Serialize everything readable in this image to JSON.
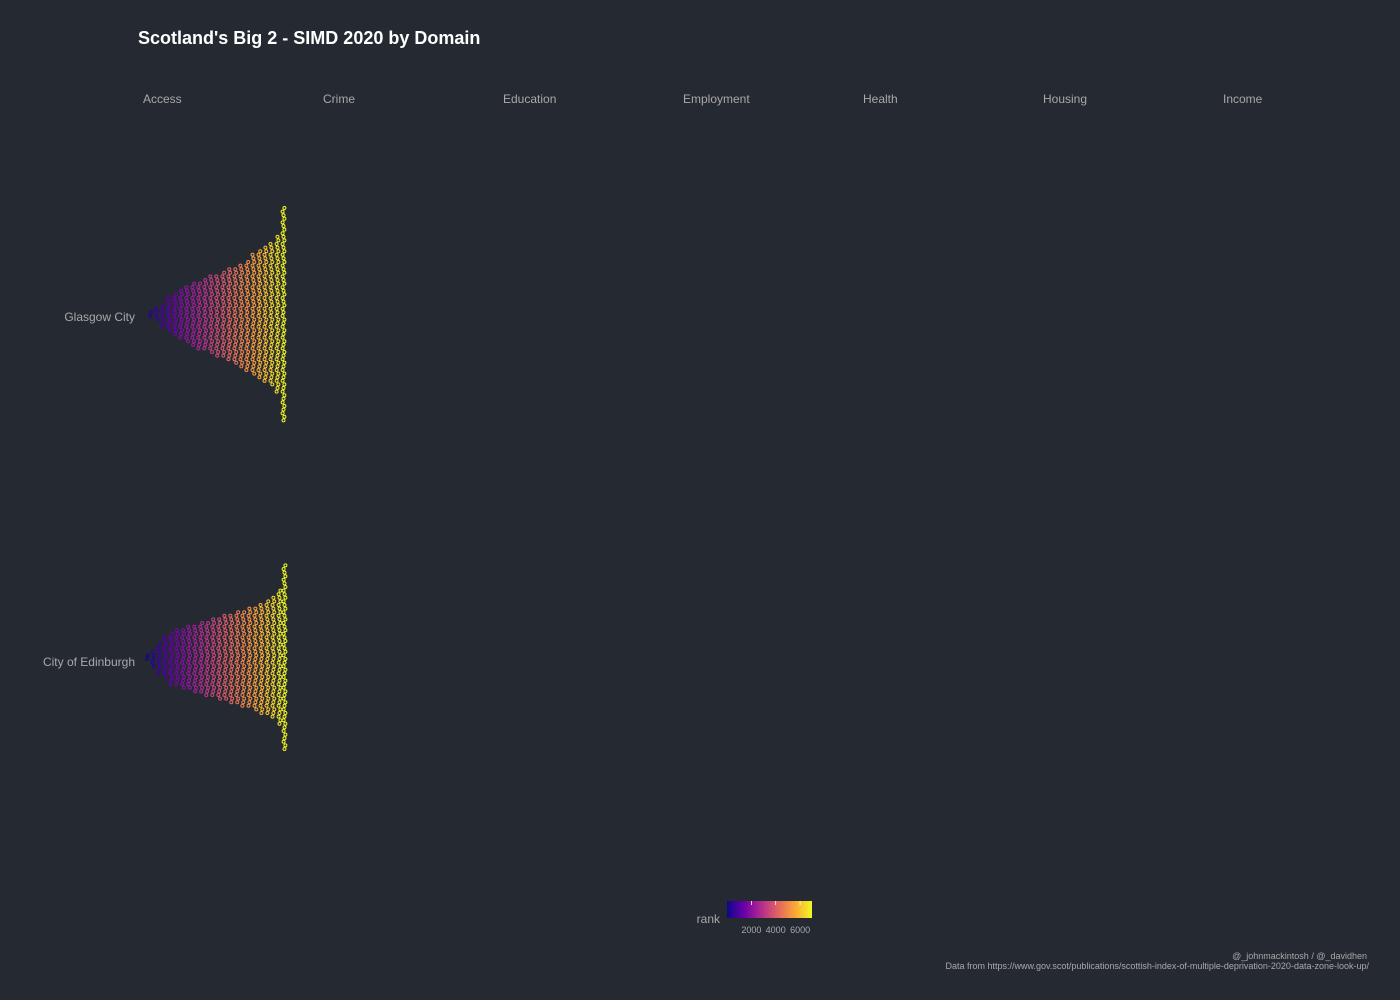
{
  "chart_data": {
    "type": "scatter",
    "title": "Scotland's Big 2 - SIMD 2020 by Domain",
    "facets": [
      "Access",
      "Crime",
      "Education",
      "Employment",
      "Health",
      "Housing",
      "Income"
    ],
    "rows": [
      "Glasgow City",
      "City of Edinburgh"
    ],
    "color_variable": "rank",
    "color_scale": {
      "name": "plasma",
      "colors": [
        "#0d0887",
        "#6a00a8",
        "#b12a90",
        "#e16462",
        "#fca636",
        "#f0f921"
      ],
      "domain": [
        1,
        6976
      ],
      "legend_ticks": [
        "2000",
        "4000",
        "6000"
      ]
    },
    "series": [
      {
        "row": "Glasgow City",
        "facet": "Access",
        "rank_bins": [
          {
            "rank": 300,
            "count": 2
          },
          {
            "rank": 600,
            "count": 4
          },
          {
            "rank": 900,
            "count": 7
          },
          {
            "rank": 1200,
            "count": 10
          },
          {
            "rank": 1500,
            "count": 12
          },
          {
            "rank": 1800,
            "count": 14
          },
          {
            "rank": 2100,
            "count": 16
          },
          {
            "rank": 2400,
            "count": 18
          },
          {
            "rank": 2700,
            "count": 19
          },
          {
            "rank": 3000,
            "count": 20
          },
          {
            "rank": 3300,
            "count": 22
          },
          {
            "rank": 3600,
            "count": 23
          },
          {
            "rank": 3900,
            "count": 24
          },
          {
            "rank": 4200,
            "count": 26
          },
          {
            "rank": 4500,
            "count": 27
          },
          {
            "rank": 4800,
            "count": 29
          },
          {
            "rank": 5100,
            "count": 31
          },
          {
            "rank": 5400,
            "count": 34
          },
          {
            "rank": 5700,
            "count": 36
          },
          {
            "rank": 6000,
            "count": 38
          },
          {
            "rank": 6300,
            "count": 40
          },
          {
            "rank": 6600,
            "count": 44
          },
          {
            "rank": 6900,
            "count": 60
          }
        ]
      },
      {
        "row": "City of Edinburgh",
        "facet": "Access",
        "rank_bins": [
          {
            "rank": 100,
            "count": 2
          },
          {
            "rank": 400,
            "count": 5
          },
          {
            "rank": 700,
            "count": 9
          },
          {
            "rank": 1000,
            "count": 12
          },
          {
            "rank": 1300,
            "count": 15
          },
          {
            "rank": 1600,
            "count": 16
          },
          {
            "rank": 1900,
            "count": 17
          },
          {
            "rank": 2200,
            "count": 18
          },
          {
            "rank": 2500,
            "count": 19
          },
          {
            "rank": 2800,
            "count": 20
          },
          {
            "rank": 3100,
            "count": 21
          },
          {
            "rank": 3400,
            "count": 22
          },
          {
            "rank": 3700,
            "count": 23
          },
          {
            "rank": 4000,
            "count": 24
          },
          {
            "rank": 4300,
            "count": 25
          },
          {
            "rank": 4600,
            "count": 26
          },
          {
            "rank": 4900,
            "count": 27
          },
          {
            "rank": 5200,
            "count": 28
          },
          {
            "rank": 5500,
            "count": 29
          },
          {
            "rank": 5800,
            "count": 31
          },
          {
            "rank": 6100,
            "count": 32
          },
          {
            "rank": 6400,
            "count": 34
          },
          {
            "rank": 6700,
            "count": 38
          },
          {
            "rank": 6950,
            "count": 52
          }
        ]
      }
    ],
    "xlabel": "",
    "ylabel": "",
    "grid": false,
    "legend_position": "bottom"
  },
  "caption": {
    "line1": "@_johnmackintosh / @_davidhen",
    "line2": "Data from https://www.gov.scot/publications/scottish-index-of-multiple-deprivation-2020-data-zone-look-up/"
  },
  "colors": {
    "background": "#252932",
    "title": "#ffffff",
    "text": "#a9a9a9"
  }
}
